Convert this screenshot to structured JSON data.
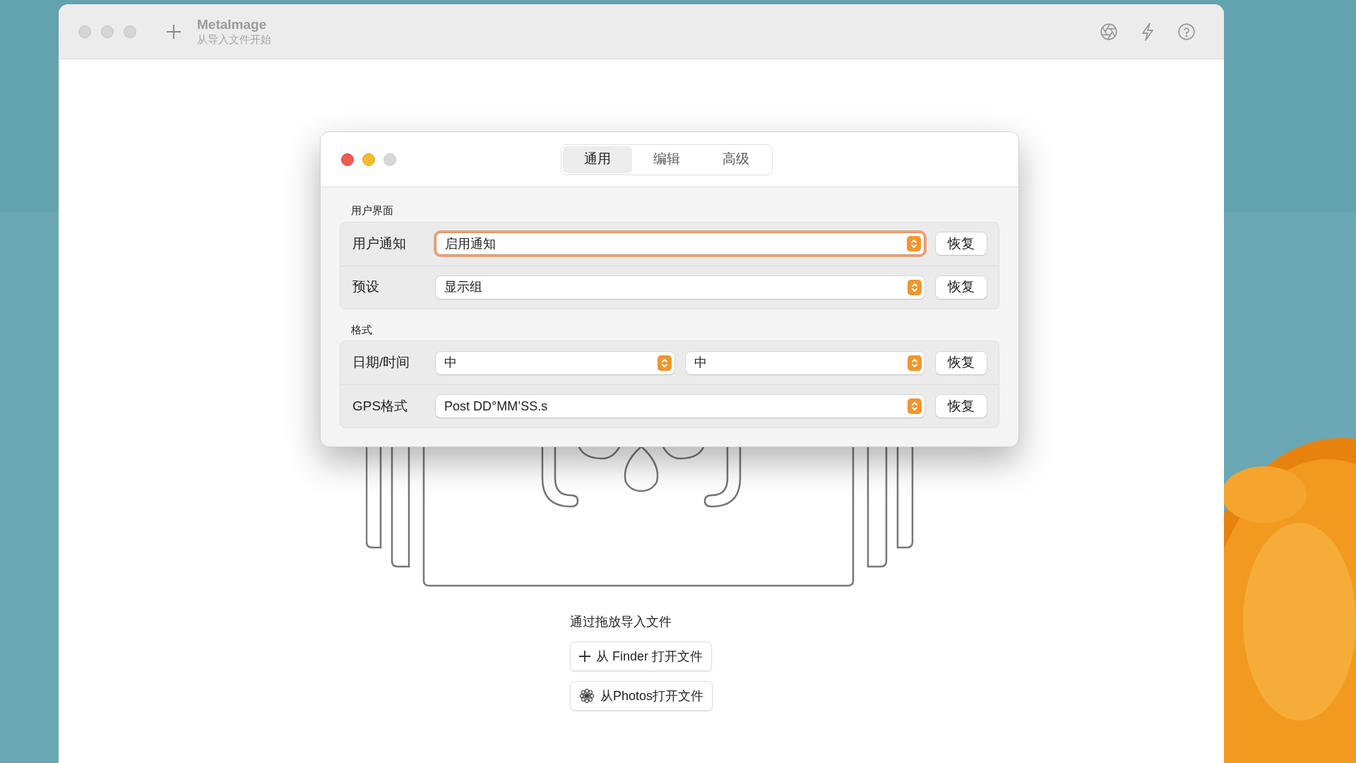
{
  "app_window": {
    "title": "MetaImage",
    "subtitle": "从导入文件开始",
    "drop_hint": "通过拖放导入文件",
    "buttons": [
      {
        "kind": "add",
        "label": "从 Finder 打开文件"
      },
      {
        "kind": "photos",
        "label": "从Photos打开文件"
      }
    ]
  },
  "settings_window": {
    "tabs": [
      {
        "label": "通用",
        "selected": true
      },
      {
        "label": "编辑",
        "selected": false
      },
      {
        "label": "高级",
        "selected": false
      }
    ],
    "sections": [
      {
        "title": "用户界面",
        "rows": [
          {
            "label": "用户通知",
            "values": [
              "启用通知"
            ],
            "focused": true,
            "reset": "恢复"
          },
          {
            "label": "预设",
            "values": [
              "显示组"
            ],
            "focused": false,
            "reset": "恢复"
          }
        ]
      },
      {
        "title": "格式",
        "rows": [
          {
            "label": "日期/时间",
            "values": [
              "中",
              "中"
            ],
            "focused": false,
            "reset": "恢复"
          },
          {
            "label": "GPS格式",
            "values": [
              "Post DD°MM’SS.s"
            ],
            "focused": false,
            "reset": "恢复"
          }
        ]
      }
    ]
  }
}
